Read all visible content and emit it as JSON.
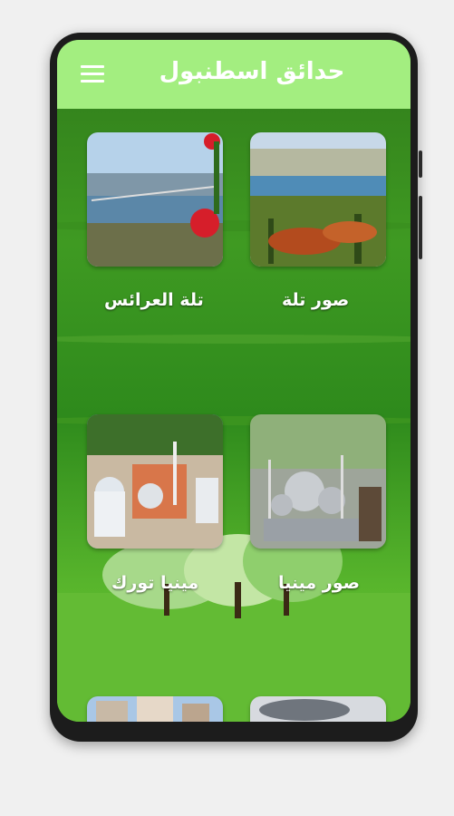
{
  "app": {
    "title": "حدائق اسطنبول"
  },
  "grid": [
    {
      "label": "صور تلة",
      "image": "istanbul-city-view"
    },
    {
      "label": "تلة العرائس",
      "image": "bosphorus-bridge-view"
    },
    {
      "label": "صور مينيا",
      "image": "miniature-mosque"
    },
    {
      "label": "مينيا تورك",
      "image": "miniature-palace"
    },
    {
      "label": "",
      "image": "cloudy-sky"
    },
    {
      "label": "",
      "image": "building-view"
    }
  ],
  "colors": {
    "appbar": "#a3ee80",
    "background": "#3f9a22",
    "text": "#ffffff"
  }
}
